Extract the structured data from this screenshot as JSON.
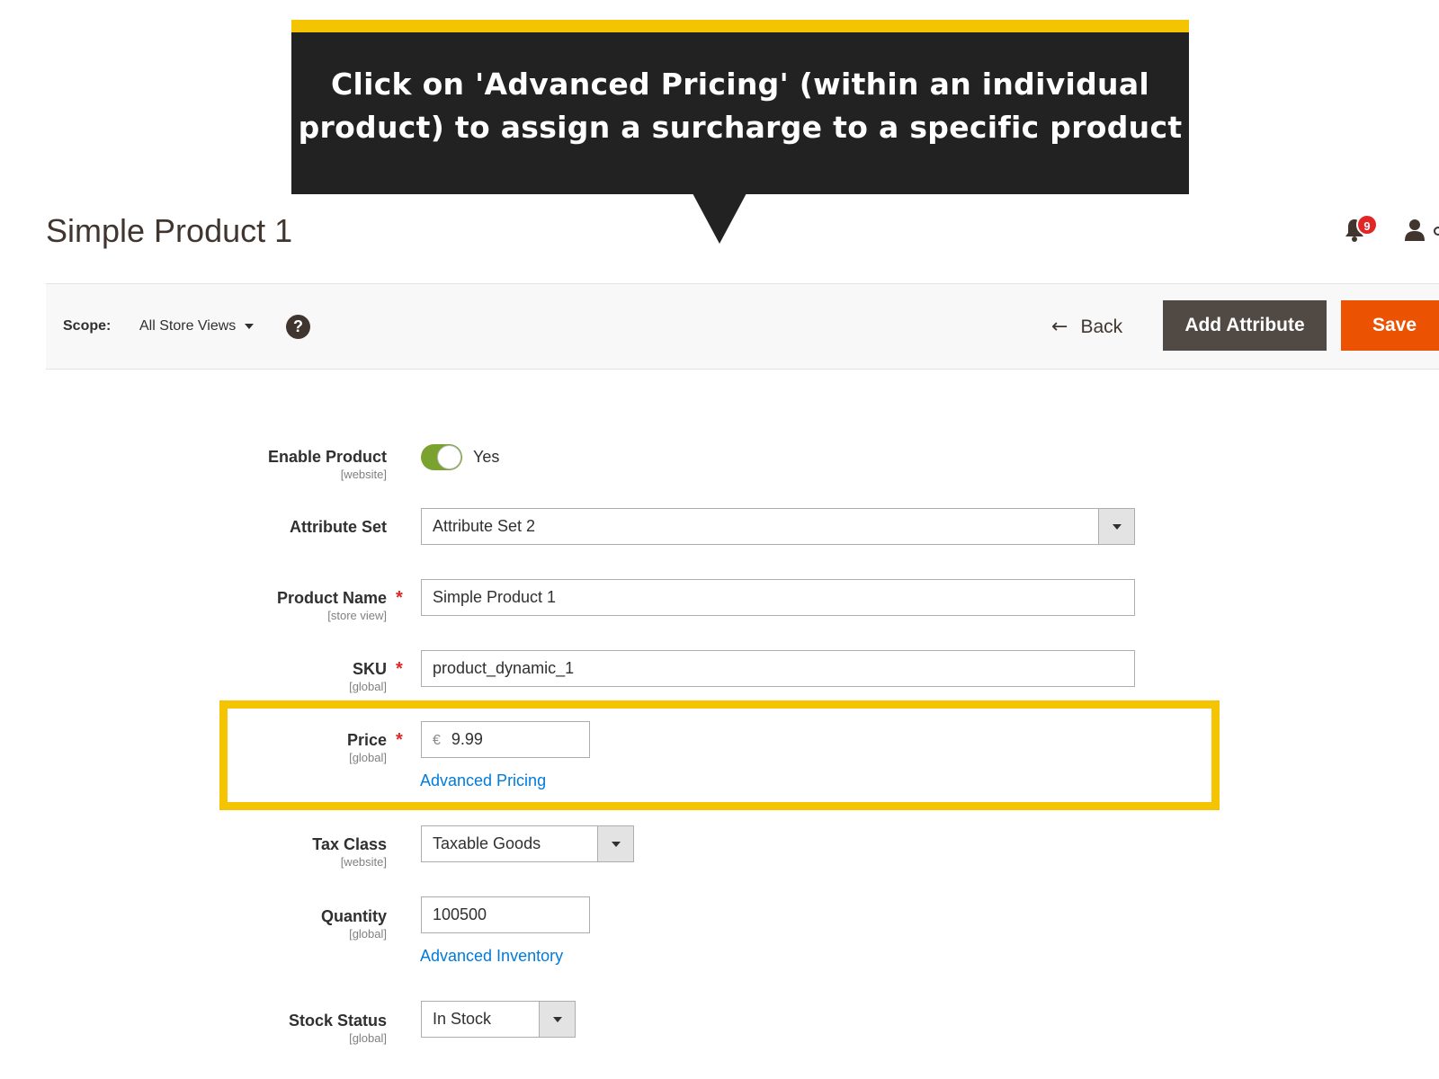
{
  "callout": {
    "line1": "Click on 'Advanced Pricing' (within an individual",
    "line2": "product) to assign a surcharge to a specific product"
  },
  "header": {
    "title": "Simple Product 1",
    "notification_count": "9"
  },
  "toolbar": {
    "scope_label": "Scope:",
    "scope_value": "All Store Views",
    "help_glyph": "?",
    "back_label": "Back",
    "add_attribute_label": "Add Attribute",
    "save_label": "Save"
  },
  "form": {
    "enable_product": {
      "label": "Enable Product",
      "scope": "[website]",
      "value": "Yes",
      "enabled": true
    },
    "attribute_set": {
      "label": "Attribute Set",
      "value": "Attribute Set 2"
    },
    "product_name": {
      "label": "Product Name",
      "scope": "[store view]",
      "value": "Simple Product 1",
      "required": true
    },
    "sku": {
      "label": "SKU",
      "scope": "[global]",
      "value": "product_dynamic_1",
      "required": true
    },
    "price": {
      "label": "Price",
      "scope": "[global]",
      "currency": "€",
      "value": "9.99",
      "required": true,
      "link": "Advanced Pricing"
    },
    "tax_class": {
      "label": "Tax Class",
      "scope": "[website]",
      "value": "Taxable Goods"
    },
    "quantity": {
      "label": "Quantity",
      "scope": "[global]",
      "value": "100500",
      "link": "Advanced Inventory"
    },
    "stock_status": {
      "label": "Stock Status",
      "scope": "[global]",
      "value": "In Stock"
    },
    "required_mark": "*"
  },
  "colors": {
    "callout_bg": "#222222",
    "callout_accent": "#f5c400",
    "save_button": "#eb5202",
    "add_attribute_button": "#514943",
    "toggle_on": "#79a22e",
    "link": "#007bdb",
    "required": "#e22626"
  },
  "icons": {
    "bell": "bell-icon",
    "user": "user-icon",
    "help": "help-icon",
    "back": "arrow-left-icon",
    "caret": "chevron-down-icon"
  }
}
